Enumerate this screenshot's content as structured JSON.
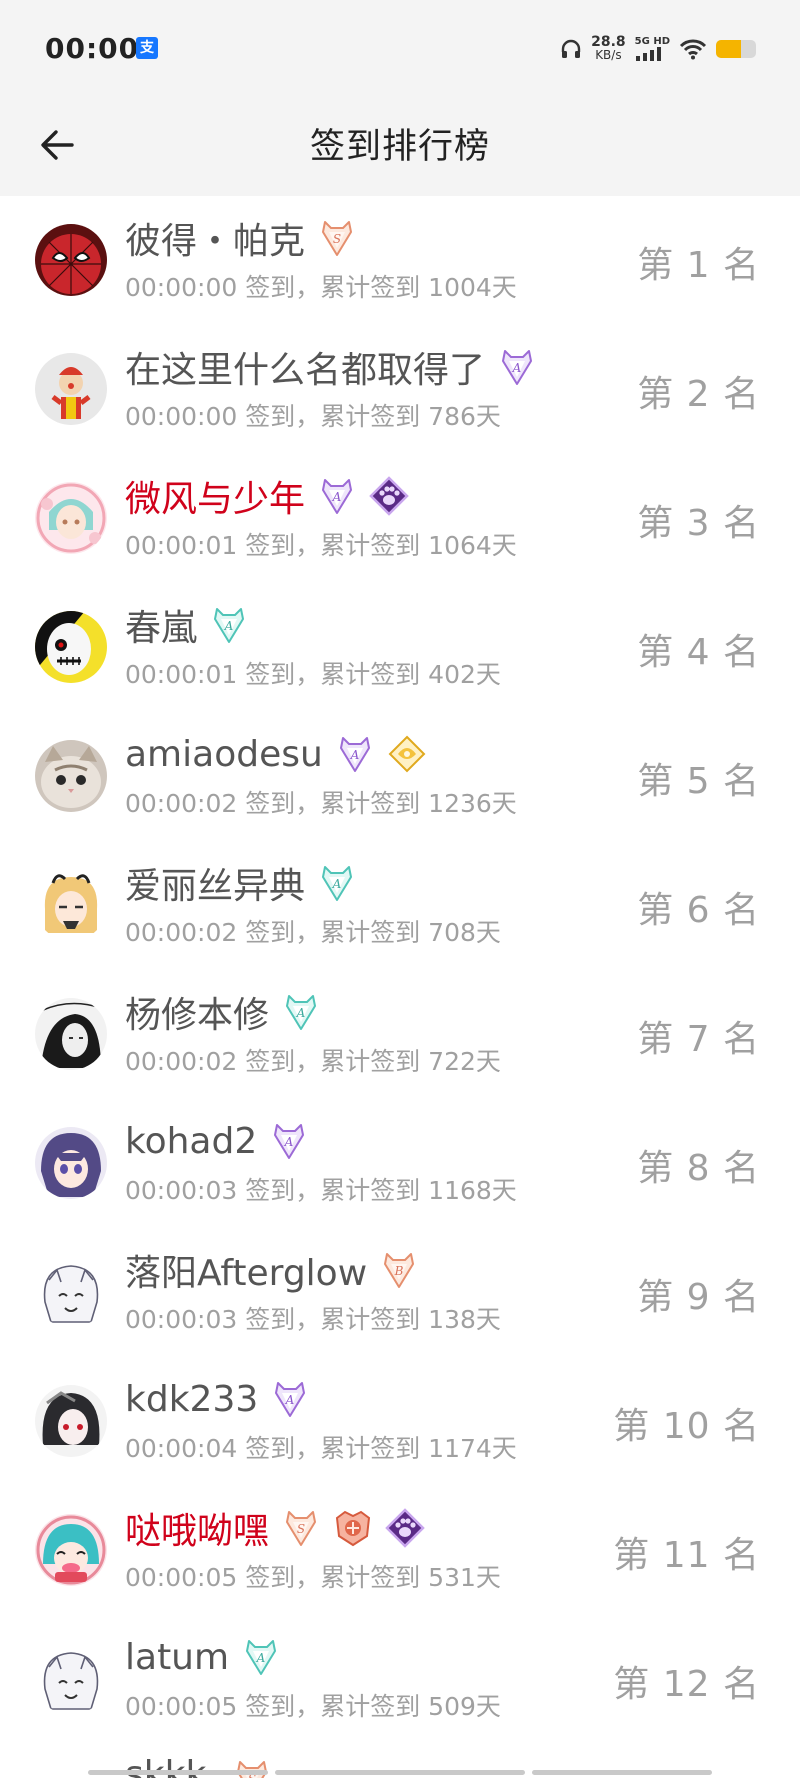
{
  "status_bar": {
    "time": "00:00",
    "app_notification_icon": "alipay-icon",
    "alipay_glyph": "支",
    "net_speed_value": "28.8",
    "net_speed_unit": "KB/s",
    "signal_label": "5G HD",
    "icons": [
      "headphones-icon",
      "signal-icon",
      "wifi-icon",
      "battery-icon"
    ],
    "battery_level_percent": 62,
    "battery_color": "#f5b400"
  },
  "header": {
    "title": "签到排行榜",
    "back_icon": "arrow-left-icon"
  },
  "rows": [
    {
      "name": "彼得・帕克",
      "name_color": "default",
      "badges": [
        "s"
      ],
      "sub": "00:00:00 签到，累计签到 1004天",
      "rank": "第 1 名",
      "avatar": "spiderman"
    },
    {
      "name": "在这里什么名都取得了",
      "name_color": "default",
      "badges": [
        "a-purple"
      ],
      "sub": "00:00:00 签到，累计签到 786天",
      "rank": "第 2 名",
      "avatar": "clown"
    },
    {
      "name": "微风与少年",
      "name_color": "red",
      "badges": [
        "a-purple",
        "paw"
      ],
      "sub": "00:00:01 签到，累计签到 1064天",
      "rank": "第 3 名",
      "avatar": "anime-teal"
    },
    {
      "name": "春嵐",
      "name_color": "default",
      "badges": [
        "a-teal"
      ],
      "sub": "00:00:01 签到，累计签到 402天",
      "rank": "第 4 名",
      "avatar": "mask"
    },
    {
      "name": "amiaodesu",
      "name_color": "default",
      "badges": [
        "a-purple",
        "gold"
      ],
      "sub": "00:00:02 签到，累计签到 1236天",
      "rank": "第 5 名",
      "avatar": "cat"
    },
    {
      "name": "爱丽丝异典",
      "name_color": "default",
      "badges": [
        "a-teal"
      ],
      "sub": "00:00:02 签到，累计签到 708天",
      "rank": "第 6 名",
      "avatar": "anime-gold"
    },
    {
      "name": "杨修本修",
      "name_color": "default",
      "badges": [
        "a-teal"
      ],
      "sub": "00:00:02 签到，累计签到 722天",
      "rank": "第 7 名",
      "avatar": "sketch"
    },
    {
      "name": "kohad2",
      "name_color": "default",
      "badges": [
        "a-purple"
      ],
      "sub": "00:00:03 签到，累计签到 1168天",
      "rank": "第 8 名",
      "avatar": "anime-purple"
    },
    {
      "name": "落阳Afterglow",
      "name_color": "default",
      "badges": [
        "b"
      ],
      "sub": "00:00:03 签到，累计签到 138天",
      "rank": "第 9 名",
      "avatar": "chibi"
    },
    {
      "name": "kdk233",
      "name_color": "default",
      "badges": [
        "a-purple"
      ],
      "sub": "00:00:04 签到，累计签到 1174天",
      "rank": "第 10 名",
      "avatar": "anime-dark"
    },
    {
      "name": "哒哦呦嘿",
      "name_color": "red",
      "badges": [
        "s",
        "crest",
        "paw"
      ],
      "sub": "00:00:05 签到，累计签到 531天",
      "rank": "第 11 名",
      "avatar": "miku"
    },
    {
      "name": "latum",
      "name_color": "default",
      "badges": [
        "a-teal"
      ],
      "sub": "00:00:05 签到，累计签到 509天",
      "rank": "第 12 名",
      "avatar": "chibi"
    }
  ],
  "partial_row": {
    "name": "skkk"
  }
}
